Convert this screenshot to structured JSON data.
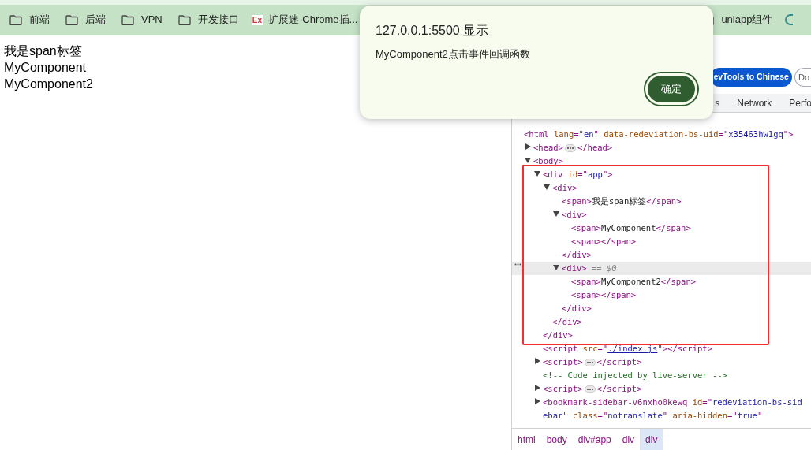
{
  "bookmarks": [
    {
      "kind": "folder",
      "label": "前端"
    },
    {
      "kind": "folder",
      "label": "后端"
    },
    {
      "kind": "folder",
      "label": "VPN"
    },
    {
      "kind": "folder",
      "label": "开发接口"
    },
    {
      "kind": "site",
      "badge": "Ex",
      "label": "扩展迷-Chrome插..."
    },
    {
      "kind": "gap"
    },
    {
      "kind": "folder",
      "label": "uniapp组件"
    },
    {
      "kind": "site-cut"
    }
  ],
  "page": {
    "lines": [
      "我是span标签",
      "MyComponent",
      "MyComponent2"
    ]
  },
  "dialog": {
    "title": "127.0.0.1:5500 显示",
    "message": "MyComponent2点击事件回调函数",
    "button": "确定"
  },
  "devtools": {
    "top_buttons": [
      {
        "label": "evTools to Chinese",
        "kind": "primary"
      },
      {
        "label": "Do",
        "kind": "outline"
      }
    ],
    "tabs": [
      {
        "label": "s"
      },
      {
        "label": "Network"
      },
      {
        "label": "Perfo"
      }
    ],
    "tree": [
      {
        "selected": false,
        "tokens": [
          {
            "kind": "tag",
            "text": "<html "
          },
          {
            "kind": "attr",
            "text": "lang"
          },
          {
            "kind": "tag",
            "text": "=\""
          },
          {
            "kind": "value",
            "text": "en"
          },
          {
            "kind": "tag",
            "text": "\" "
          },
          {
            "kind": "attr",
            "text": "data-redeviation-bs-uid"
          },
          {
            "kind": "tag",
            "text": "=\""
          },
          {
            "kind": "value",
            "text": "x35463hw1gq"
          },
          {
            "kind": "tag",
            "text": "\">"
          }
        ],
        "children": [
          {
            "expanded": false,
            "selected": false,
            "tokens": [
              {
                "kind": "tag",
                "text": "<head>"
              },
              {
                "kind": "ellipsis"
              },
              {
                "kind": "tag",
                "text": "</head>"
              }
            ]
          },
          {
            "expanded": true,
            "selected": false,
            "tokens": [
              {
                "kind": "tag",
                "text": "<body>"
              }
            ],
            "children": [
              {
                "expanded": true,
                "selected": false,
                "tokens": [
                  {
                    "kind": "tag",
                    "text": "<div "
                  },
                  {
                    "kind": "attr",
                    "text": "id"
                  },
                  {
                    "kind": "tag",
                    "text": "=\""
                  },
                  {
                    "kind": "value",
                    "text": "app"
                  },
                  {
                    "kind": "tag",
                    "text": "\">"
                  }
                ],
                "children": [
                  {
                    "expanded": true,
                    "selected": false,
                    "tokens": [
                      {
                        "kind": "tag",
                        "text": "<div>"
                      }
                    ],
                    "children": [
                      {
                        "selected": false,
                        "tokens": [
                          {
                            "kind": "tag",
                            "text": "<span>"
                          },
                          {
                            "kind": "text",
                            "text": "我是span标签"
                          },
                          {
                            "kind": "tag",
                            "text": "</span>"
                          }
                        ]
                      },
                      {
                        "expanded": true,
                        "selected": false,
                        "tokens": [
                          {
                            "kind": "tag",
                            "text": "<div>"
                          }
                        ],
                        "children": [
                          {
                            "selected": false,
                            "tokens": [
                              {
                                "kind": "tag",
                                "text": "<span>"
                              },
                              {
                                "kind": "text",
                                "text": "MyComponent"
                              },
                              {
                                "kind": "tag",
                                "text": "</span>"
                              }
                            ]
                          },
                          {
                            "selected": false,
                            "tokens": [
                              {
                                "kind": "tag",
                                "text": "<span></span>"
                              }
                            ]
                          }
                        ],
                        "close": [
                          {
                            "kind": "tag",
                            "text": "</div>"
                          }
                        ]
                      },
                      {
                        "expanded": true,
                        "selected": true,
                        "tokens": [
                          {
                            "kind": "tag",
                            "text": "<div>"
                          },
                          {
                            "kind": "marker",
                            "text": " == $0"
                          }
                        ],
                        "children": [
                          {
                            "selected": false,
                            "tokens": [
                              {
                                "kind": "tag",
                                "text": "<span>"
                              },
                              {
                                "kind": "text",
                                "text": "MyComponent2"
                              },
                              {
                                "kind": "tag",
                                "text": "</span>"
                              }
                            ]
                          },
                          {
                            "selected": false,
                            "tokens": [
                              {
                                "kind": "tag",
                                "text": "<span></span>"
                              }
                            ]
                          }
                        ],
                        "close": [
                          {
                            "kind": "tag",
                            "text": "</div>"
                          }
                        ]
                      }
                    ],
                    "close": [
                      {
                        "kind": "tag",
                        "text": "</div>"
                      }
                    ]
                  }
                ],
                "close": [
                  {
                    "kind": "tag",
                    "text": "</div>"
                  }
                ]
              },
              {
                "selected": false,
                "tokens": [
                  {
                    "kind": "tag",
                    "text": "<script "
                  },
                  {
                    "kind": "attr",
                    "text": "src"
                  },
                  {
                    "kind": "tag",
                    "text": "=\""
                  },
                  {
                    "kind": "link",
                    "text": "./index.js"
                  },
                  {
                    "kind": "tag",
                    "text": "\"></script>"
                  }
                ]
              },
              {
                "expanded": false,
                "selected": false,
                "tokens": [
                  {
                    "kind": "tag",
                    "text": "<script>"
                  },
                  {
                    "kind": "ellipsis"
                  },
                  {
                    "kind": "tag",
                    "text": "</script>"
                  }
                ]
              },
              {
                "selected": false,
                "tokens": [
                  {
                    "kind": "comment",
                    "text": "<!-- Code injected by live-server -->"
                  }
                ]
              },
              {
                "expanded": false,
                "selected": false,
                "tokens": [
                  {
                    "kind": "tag",
                    "text": "<script>"
                  },
                  {
                    "kind": "ellipsis"
                  },
                  {
                    "kind": "tag",
                    "text": "</script>"
                  }
                ]
              },
              {
                "expanded": false,
                "selected": false,
                "tokens": [
                  {
                    "kind": "tag",
                    "text": "<bookmark-sidebar-v6nxho0kewq "
                  },
                  {
                    "kind": "attr",
                    "text": "id"
                  },
                  {
                    "kind": "tag",
                    "text": "=\""
                  },
                  {
                    "kind": "value",
                    "text": "redeviation-bs-sidebar"
                  },
                  {
                    "kind": "tag",
                    "text": "\" "
                  },
                  {
                    "kind": "attr",
                    "text": "class"
                  },
                  {
                    "kind": "tag",
                    "text": "=\""
                  },
                  {
                    "kind": "value",
                    "text": "notranslate"
                  },
                  {
                    "kind": "tag",
                    "text": "\" "
                  },
                  {
                    "kind": "attr",
                    "text": "aria-hidden"
                  },
                  {
                    "kind": "tag",
                    "text": "=\""
                  },
                  {
                    "kind": "value",
                    "text": "true"
                  },
                  {
                    "kind": "tag",
                    "text": "\""
                  }
                ]
              }
            ]
          }
        ]
      }
    ],
    "breadcrumbs": [
      {
        "label": "html",
        "selected": false
      },
      {
        "label": "body",
        "selected": false
      },
      {
        "label": "div#app",
        "selected": false
      },
      {
        "label": "div",
        "selected": false
      },
      {
        "label": "div",
        "selected": true
      }
    ]
  }
}
